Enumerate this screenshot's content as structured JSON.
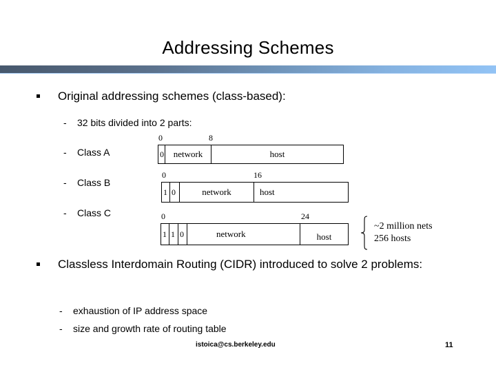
{
  "slide": {
    "title": "Addressing Schemes",
    "accent_dark": "#47586d",
    "accent_light": "#92c3f5"
  },
  "body": {
    "bullet1": "Original addressing schemes (class-based):",
    "sub1": "32 bits divided into 2 parts:",
    "sub_class_a": "Class A",
    "sub_class_b": "Class B",
    "sub_class_c": "Class C",
    "bullet2": "Classless Interdomain Routing (CIDR) introduced to solve 2 problems:",
    "sub2": "exhaustion of IP address space",
    "sub3": "size and growth rate of routing table"
  },
  "diagrams": {
    "class_a": {
      "ticks": {
        "left": "0",
        "right": "8"
      },
      "cells": [
        {
          "label": "0"
        },
        {
          "label": "network"
        },
        {
          "label": "host"
        }
      ]
    },
    "class_b": {
      "ticks": {
        "left": "0",
        "right": "16"
      },
      "cells": [
        {
          "label": "1"
        },
        {
          "label": "0"
        },
        {
          "label": "network"
        },
        {
          "label": "host"
        }
      ]
    },
    "class_c": {
      "ticks": {
        "left": "0",
        "right": "24"
      },
      "cells": [
        {
          "label": "1"
        },
        {
          "label": "1"
        },
        {
          "label": "0"
        },
        {
          "label": "network"
        },
        {
          "label": "host"
        }
      ]
    }
  },
  "annotation": {
    "line1": "~2 million nets",
    "line2": "256 hosts"
  },
  "footer": {
    "email": "istoica@cs.berkeley.edu",
    "page": "11"
  }
}
